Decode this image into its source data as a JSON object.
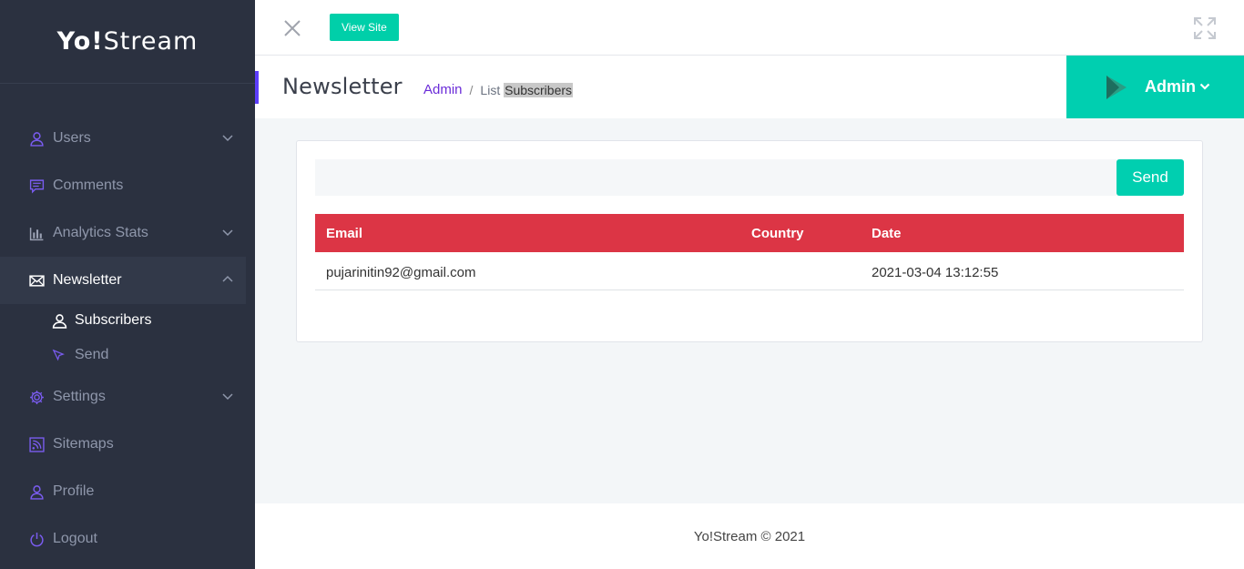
{
  "brand": {
    "name_bold": "Yo!",
    "name_rest": "Stream"
  },
  "sidebar": {
    "items": [
      {
        "label": "Users",
        "icon": "user-icon",
        "has_chevron": true
      },
      {
        "label": "Comments",
        "icon": "comment-icon",
        "has_chevron": false
      },
      {
        "label": "Analytics Stats",
        "icon": "bar-chart-icon",
        "has_chevron": true
      },
      {
        "label": "Newsletter",
        "icon": "envelope-icon",
        "has_chevron": true,
        "expanded": true
      },
      {
        "label": "Settings",
        "icon": "gear-icon",
        "has_chevron": true
      },
      {
        "label": "Sitemaps",
        "icon": "rss-icon",
        "has_chevron": false
      },
      {
        "label": "Profile",
        "icon": "user-icon",
        "has_chevron": false
      },
      {
        "label": "Logout",
        "icon": "power-icon",
        "has_chevron": false
      }
    ],
    "newsletter_sub": [
      {
        "label": "Subscribers",
        "icon": "user-icon",
        "current": true
      },
      {
        "label": "Send",
        "icon": "cursor-icon",
        "current": false
      }
    ]
  },
  "topbar": {
    "view_site_label": "View Site"
  },
  "page": {
    "title": "Newsletter",
    "breadcrumb": {
      "root": "Admin",
      "separator": "/",
      "list": "List",
      "current": "Subscribers"
    }
  },
  "user_menu": {
    "label": "Admin"
  },
  "send_form": {
    "input_value": "",
    "send_label": "Send"
  },
  "table": {
    "headers": [
      "Email",
      "Country",
      "Date"
    ],
    "rows": [
      {
        "email": "pujarinitin92@gmail.com",
        "country": "",
        "date": "2021-03-04 13:12:55"
      }
    ]
  },
  "footer": {
    "text": "Yo!Stream © 2021"
  },
  "colors": {
    "sidebar_bg": "#2b3140",
    "accent_teal": "#00cfb0",
    "table_header": "#dc3545",
    "purple_link": "#6a2bd8"
  }
}
